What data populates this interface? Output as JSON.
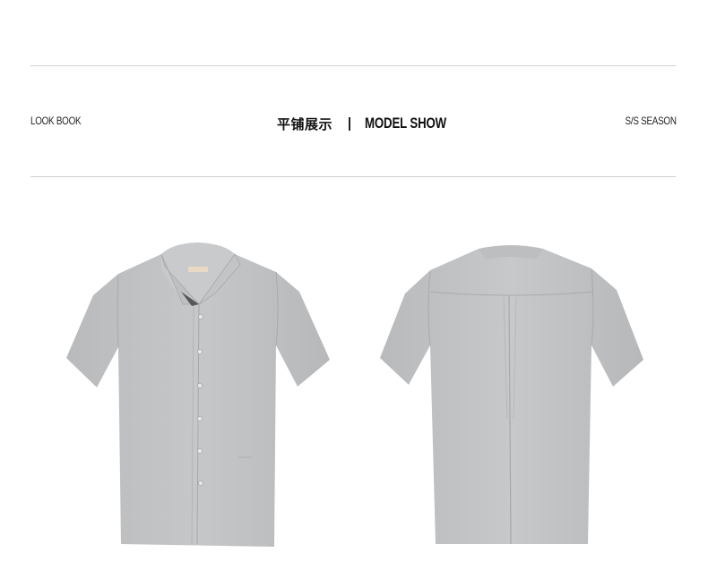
{
  "header": {
    "left_label": "LOOK BOOK",
    "center_title_cn": "平铺展示",
    "center_title_en": "MODEL SHOW",
    "right_label": "S/S SEASON"
  },
  "products": [
    {
      "view": "front",
      "color": "#c4c5c7"
    },
    {
      "view": "back",
      "color": "#c4c5c7"
    }
  ]
}
